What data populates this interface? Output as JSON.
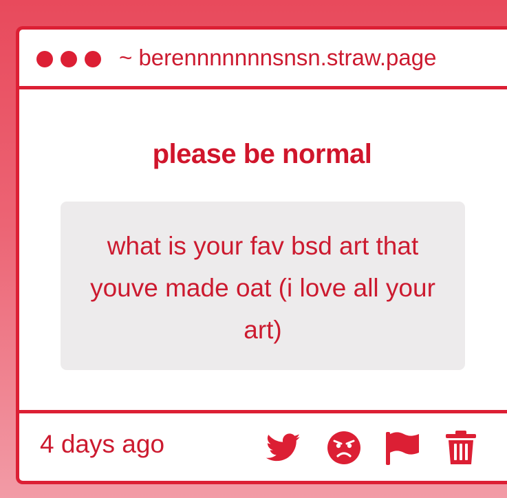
{
  "window": {
    "url": "~ berennnnnnnsnsn.straw.page"
  },
  "post": {
    "title": "please be normal",
    "question": "what is your fav bsd art that youve made oat (i love all your art)",
    "timestamp": "4 days ago"
  },
  "actions": [
    {
      "name": "twitter-share",
      "icon": "twitter-icon"
    },
    {
      "name": "react-angry",
      "icon": "angry-face-icon"
    },
    {
      "name": "report",
      "icon": "flag-icon"
    },
    {
      "name": "delete",
      "icon": "trash-icon"
    }
  ],
  "colors": {
    "accent": "#dc1f34",
    "text": "#cc1a2f",
    "question_bg": "#edebec",
    "page_bg_top": "#e84a5c",
    "page_bg_bottom": "#f29ba6"
  }
}
